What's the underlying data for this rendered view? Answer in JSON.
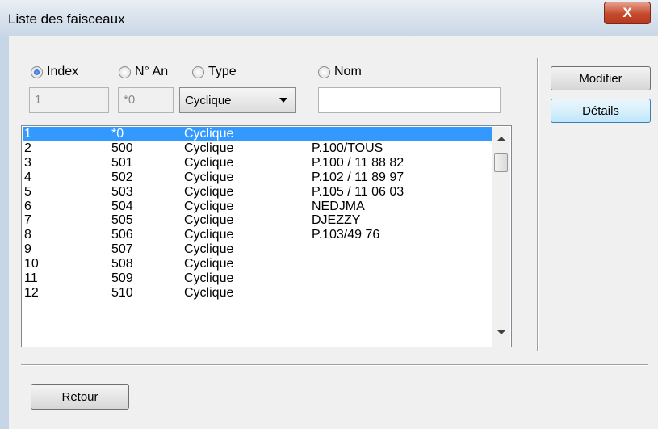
{
  "window": {
    "title": "Liste des faisceaux",
    "close_label": "X"
  },
  "filters": {
    "radios": [
      {
        "label": "Index",
        "checked": true
      },
      {
        "label": "N° An",
        "checked": false
      },
      {
        "label": "Type",
        "checked": false
      },
      {
        "label": "Nom",
        "checked": false
      }
    ],
    "index_value": "1",
    "nan_value": "*0",
    "type_value": "Cyclique",
    "nom_value": ""
  },
  "list": {
    "selected_index": 0,
    "rows": [
      [
        "1",
        "*0",
        "Cyclique",
        ""
      ],
      [
        "2",
        "500",
        "Cyclique",
        "P.100/TOUS"
      ],
      [
        "3",
        "501",
        "Cyclique",
        "P.100 / 11 88 82"
      ],
      [
        "4",
        "502",
        "Cyclique",
        "P.102 / 11 89 97"
      ],
      [
        "5",
        "503",
        "Cyclique",
        "P.105 / 11 06 03"
      ],
      [
        "6",
        "504",
        "Cyclique",
        "NEDJMA"
      ],
      [
        "7",
        "505",
        "Cyclique",
        "DJEZZY"
      ],
      [
        "8",
        "506",
        "Cyclique",
        "P.103/49 76"
      ],
      [
        "9",
        "507",
        "Cyclique",
        ""
      ],
      [
        "10",
        "508",
        "Cyclique",
        ""
      ],
      [
        "11",
        "509",
        "Cyclique",
        ""
      ],
      [
        "12",
        "510",
        "Cyclique",
        ""
      ]
    ]
  },
  "buttons": {
    "modifier": "Modifier",
    "details": "Détails",
    "retour": "Retour"
  }
}
